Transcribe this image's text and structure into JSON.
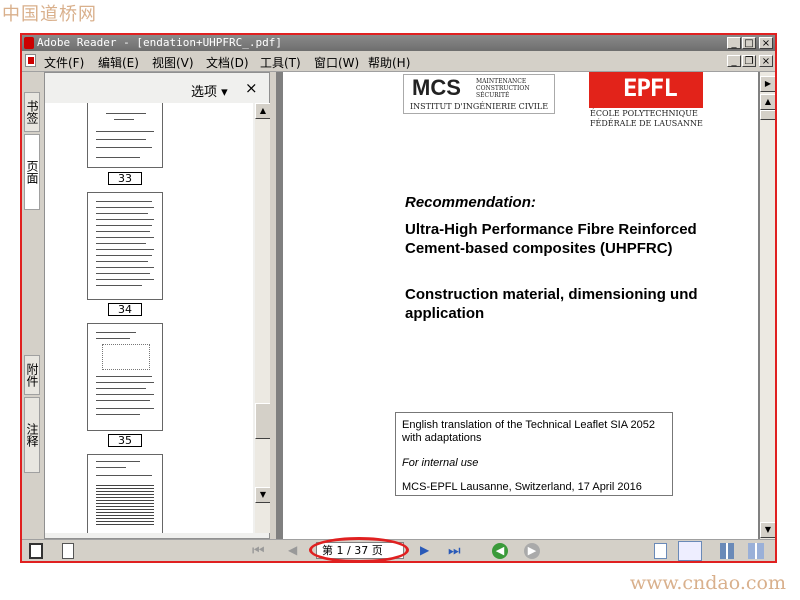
{
  "watermark": {
    "top": "中国道桥网",
    "bottom": "www.cndao.com"
  },
  "window": {
    "title": "Adobe Reader - [endation+UHPFRC_.pdf]",
    "controls": {
      "minimize": "_",
      "maximize": "□",
      "close": "×",
      "restore": "❐"
    }
  },
  "menu": [
    "文件(F)",
    "编辑(E)",
    "视图(V)",
    "文档(D)",
    "工具(T)",
    "窗口(W)",
    "帮助(H)"
  ],
  "side_tabs": [
    "书签",
    "页面",
    "附件",
    "注释"
  ],
  "thumbnails": {
    "options_label": "选项",
    "close_label": "×",
    "pages": [
      "33",
      "34",
      "35",
      ""
    ]
  },
  "document": {
    "mcs_logo": "MCS",
    "mcs_sub": [
      "MAINTENANCE",
      "CONSTRUCTION",
      "SÉCURITÉ"
    ],
    "mcs_institute": "INSTITUT D'INGÉNIERIE CIVILE",
    "epfl_logo": "EPFL",
    "epfl_sub": [
      "ÉCOLE POLYTECHNIQUE",
      "FÉDÉRALE DE LAUSANNE"
    ],
    "heading": "Recommendation:",
    "title_lines": [
      "Ultra-High Performance Fibre Reinforced",
      "Cement-based composites (UHPFRC)"
    ],
    "subtitle_lines": [
      "Construction material, dimensioning und",
      "application"
    ],
    "info": {
      "line1": "English translation of the Technical Leaflet SIA 2052",
      "line2": "with adaptations",
      "line3": "For internal use",
      "line4": "MCS-EPFL Lausanne, Switzerland, 17 April 2016"
    }
  },
  "navigation": {
    "page_indicator": "第 1 / 37 页"
  },
  "colors": {
    "highlight": "#e02020",
    "epfl_red": "#e2231a",
    "watermark": "#d9b08c"
  }
}
